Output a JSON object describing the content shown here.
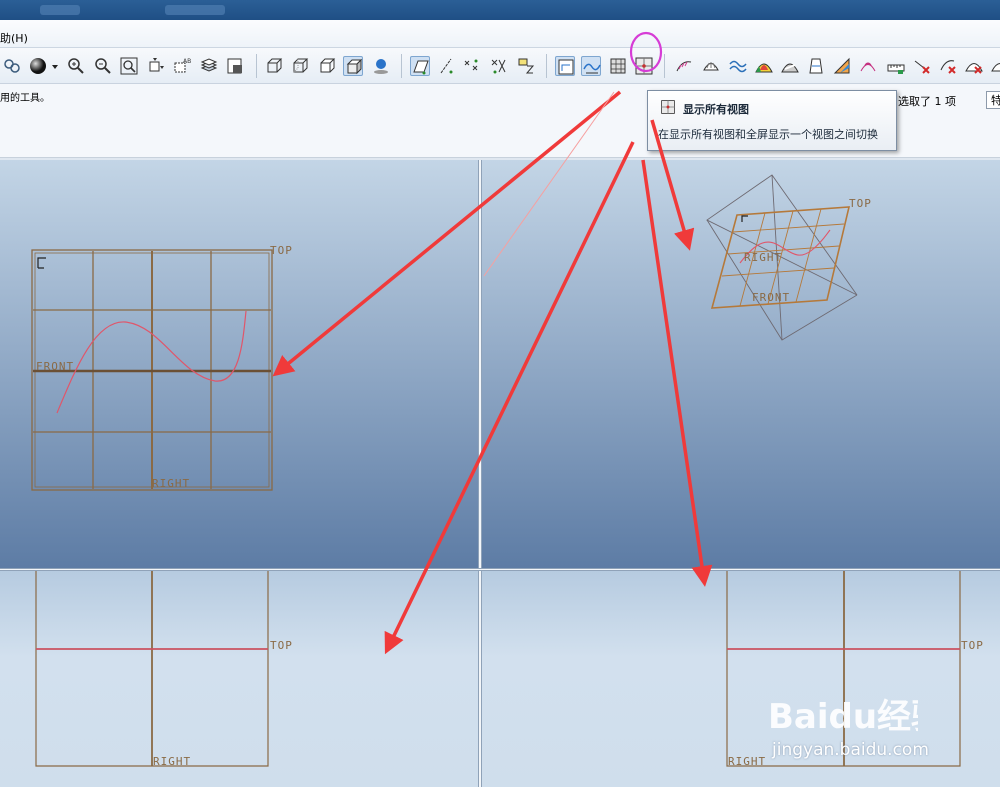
{
  "menu": {
    "help_label": "助(H)"
  },
  "message": {
    "text": "用的工具。",
    "selection_status": "选取了 1 项",
    "filter_value": "特"
  },
  "tooltip": {
    "title": "显示所有视图",
    "description": "在显示所有视图和全屏显示一个视图之间切换"
  },
  "toolbar": {
    "buttons": [
      "regenerate-icon",
      "shade-sphere-icon",
      "dropdown-arrow-icon",
      "zoom-in-icon",
      "zoom-out-icon",
      "refit-icon",
      "reorient-icon",
      "saved-views-icon",
      "layers-icon",
      "view-manager-icon",
      "wireframe-icon",
      "hidden-line-icon",
      "no-hidden-icon",
      "shading-icon",
      "enhanced-realism-icon",
      "datum-planes-icon",
      "datum-axes-icon",
      "datum-points-icon",
      "coordinate-systems-icon",
      "annotations-icon",
      "view-orient-icon",
      "sketch-view-icon",
      "grid-icon",
      "show-all-views-icon",
      "curve-analysis-icon",
      "surface-analysis-icon",
      "curve-icon",
      "color-map-icon",
      "reflection-icon",
      "draft-icon",
      "slope-icon",
      "section-icon",
      "measure-icon",
      "delete-analysis-icon",
      "save-analysis-icon",
      "hide-analysis-icon",
      "analysis-options-icon"
    ]
  },
  "viewports": {
    "top_left": {
      "label_top": "TOP",
      "label_front": "FRONT",
      "label_right": "RIGHT"
    },
    "top_right": {
      "label_top": "TOP",
      "label_right": "RIGHT",
      "label_front": "FRONT"
    },
    "bottom_left": {
      "label_top": "TOP",
      "label_right": "RIGHT"
    },
    "bottom_right": {
      "label_top": "TOP",
      "label_right": "RIGHT"
    }
  },
  "colors": {
    "datum": "#8a6a45",
    "curve": "#e0566a",
    "arrow": "#f03a3a",
    "highlight_ring": "#d63cd6"
  },
  "watermark": {
    "logo_text": "Baidu经验",
    "url": "jingyan.baidu.com"
  }
}
